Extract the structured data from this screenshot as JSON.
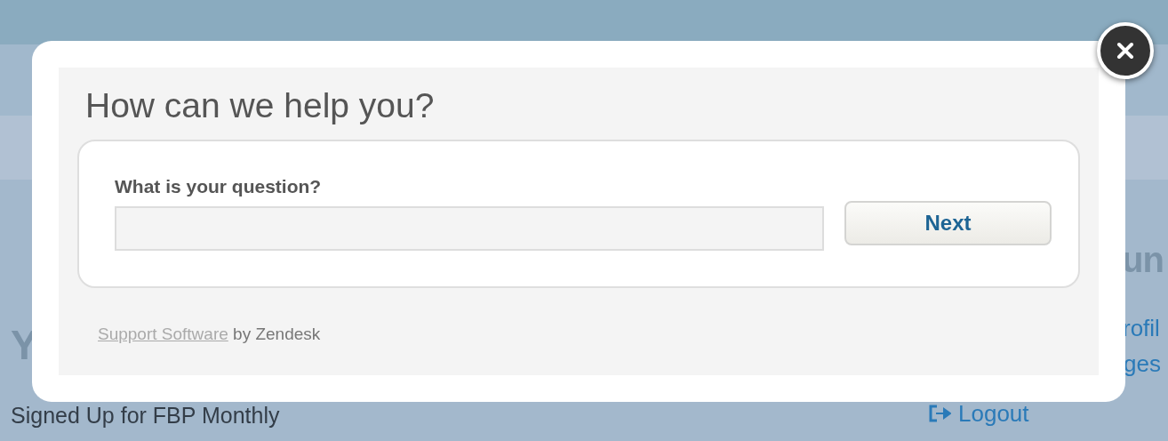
{
  "background_page": {
    "subheading": "Y",
    "plan_text": "Signed Up for FBP Monthly",
    "side_heading": "un",
    "side_links": [
      {
        "label": "rofil",
        "kind": "link"
      },
      {
        "label": "ges",
        "kind": "link"
      },
      {
        "label": "Logout",
        "kind": "logout"
      }
    ]
  },
  "dialog": {
    "title": "How can we help you?",
    "question_label": "What is your question?",
    "next_button": "Next",
    "footer": {
      "link": "Support Software",
      "text": "by Zendesk"
    }
  }
}
